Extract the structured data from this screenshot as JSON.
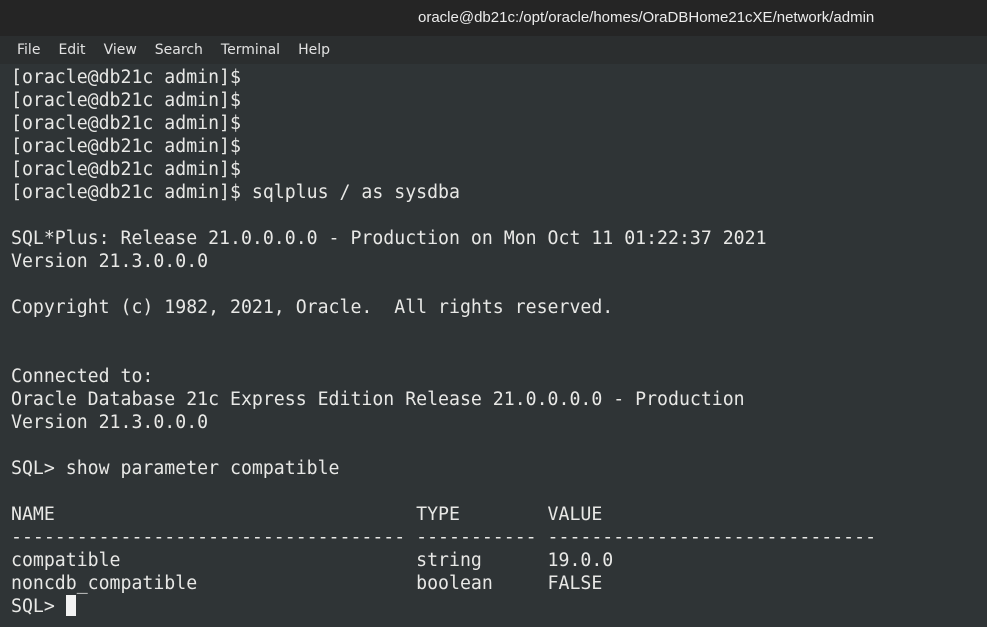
{
  "window": {
    "title": "oracle@db21c:/opt/oracle/homes/OraDBHome21cXE/network/admin"
  },
  "menu": {
    "items": [
      "File",
      "Edit",
      "View",
      "Search",
      "Terminal",
      "Help"
    ]
  },
  "terminal": {
    "lines": [
      "[oracle@db21c admin]$",
      "[oracle@db21c admin]$",
      "[oracle@db21c admin]$",
      "[oracle@db21c admin]$",
      "[oracle@db21c admin]$",
      "[oracle@db21c admin]$ sqlplus / as sysdba",
      "",
      "SQL*Plus: Release 21.0.0.0.0 - Production on Mon Oct 11 01:22:37 2021",
      "Version 21.3.0.0.0",
      "",
      "Copyright (c) 1982, 2021, Oracle.  All rights reserved.",
      "",
      "",
      "Connected to:",
      "Oracle Database 21c Express Edition Release 21.0.0.0.0 - Production",
      "Version 21.3.0.0.0",
      "",
      "SQL> show parameter compatible",
      "",
      "NAME                                 TYPE        VALUE",
      "------------------------------------ ----------- ------------------------------",
      "compatible                           string      19.0.0",
      "noncdb_compatible                    boolean     FALSE"
    ],
    "prompt": "SQL> "
  }
}
